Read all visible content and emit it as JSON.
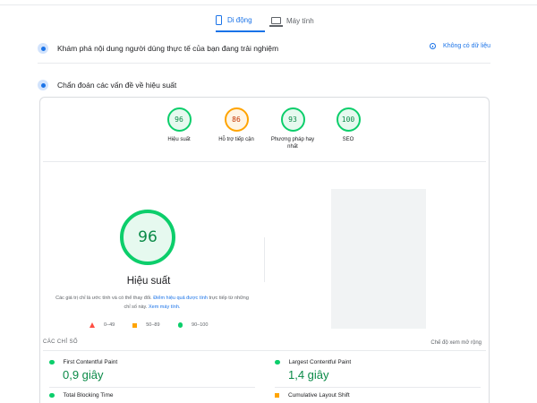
{
  "tabs": {
    "mobile": "Di động",
    "desktop": "Máy tính"
  },
  "field_data": {
    "label": "Khám phá nội dung người dùng thực tế của bạn đang trải nghiệm",
    "no_data": "Không có dữ liệu"
  },
  "diagnose": {
    "label": "Chẩn đoán các vấn đề về hiệu suất"
  },
  "gauges": [
    {
      "score": "96",
      "label": "Hiệu suất",
      "status": "pass"
    },
    {
      "score": "86",
      "label": "Hỗ trợ tiếp cận",
      "status": "average"
    },
    {
      "score": "93",
      "label": "Phương pháp hay nhất",
      "status": "pass"
    },
    {
      "score": "100",
      "label": "SEO",
      "status": "pass"
    }
  ],
  "performance": {
    "score": "96",
    "title": "Hiệu suất",
    "note_prefix": "Các giá trị chỉ là ước tính và có thể thay đổi.",
    "note_link1": "Điểm hiệu quả được tính",
    "note_middle": "trực tiếp từ những chỉ số này.",
    "note_link2": "Xem máy tính."
  },
  "legend": [
    {
      "range": "0–49",
      "shape": "triangle",
      "color": "#ff4e42"
    },
    {
      "range": "50–89",
      "shape": "square",
      "color": "#ffa400"
    },
    {
      "range": "90–100",
      "shape": "circle",
      "color": "#0cce6b"
    }
  ],
  "metrics_header": {
    "title": "CÁC CHỈ SỐ",
    "expand": "Chế độ xem mở rộng"
  },
  "metrics": [
    {
      "name": "First Contentful Paint",
      "value": "0,9 giây",
      "status": "pass"
    },
    {
      "name": "Largest Contentful Paint",
      "value": "1,4 giây",
      "status": "pass"
    },
    {
      "name": "Total Blocking Time",
      "value": "",
      "status": "pass"
    },
    {
      "name": "Cumulative Layout Shift",
      "value": "",
      "status": "average"
    }
  ],
  "colors": {
    "accent": "#1a73e8",
    "pass": "#0cce6b",
    "average": "#ffa400",
    "fail": "#ff4e42"
  }
}
